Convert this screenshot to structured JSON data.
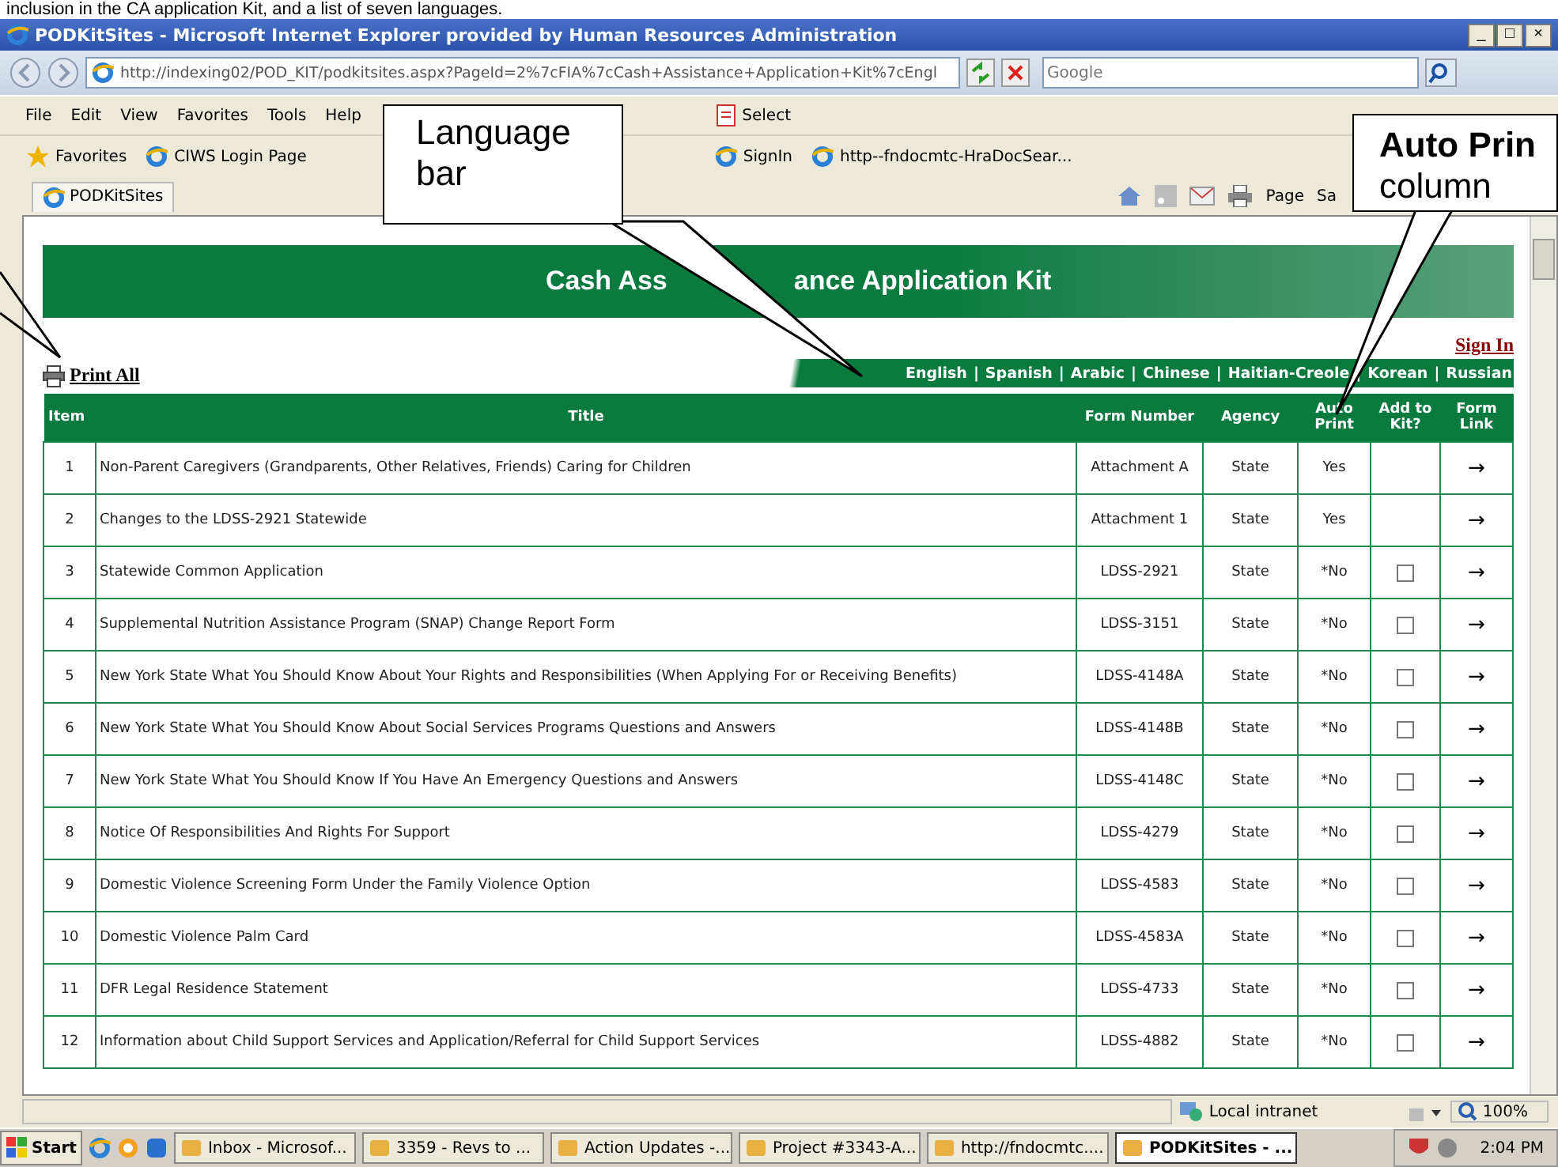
{
  "caption": "inclusion in the CA application Kit, and a list of seven languages.",
  "window": {
    "title": "PODKitSites - Microsoft Internet Explorer provided by Human Resources Administration",
    "controls": [
      "_",
      "□",
      "×"
    ]
  },
  "address_bar": {
    "url": "http://indexing02/POD_KIT/podkitsites.aspx?PageId=2%7cFIA%7cCash+Assistance+Application+Kit%7cEngl",
    "search_placeholder": "Google"
  },
  "menu": [
    "File",
    "Edit",
    "View",
    "Favorites",
    "Tools",
    "Help"
  ],
  "toolbar_right": [
    "Select"
  ],
  "favorites_bar": {
    "label": "Favorites",
    "items": [
      "CIWS Login Page",
      "SignIn",
      "http--fndocmtc-HraDocSear..."
    ]
  },
  "browser_tab": {
    "title": "PODKitSites"
  },
  "command_bar": [
    "Page",
    "Sa"
  ],
  "page": {
    "banner": [
      "Cash Ass",
      "ance Application Kit"
    ],
    "separator": "|",
    "sign_in": "Sign In",
    "print_all": "Print All",
    "languages": [
      "English",
      "Spanish",
      "Arabic",
      "Chinese",
      "Haitian-Creole",
      "Korean",
      "Russian"
    ],
    "table": {
      "columns": [
        "Item",
        "Title",
        "Form Number",
        "Agency",
        "Auto Print",
        "Add to Kit?",
        "Form Link"
      ],
      "rows": [
        {
          "item": "1",
          "title": "Non-Parent Caregivers (Grandparents, Other Relatives, Friends) Caring for Children",
          "form": "Attachment A",
          "agency": "State",
          "auto_print": "Yes",
          "link": "→"
        },
        {
          "item": "2",
          "title": "Changes to the LDSS-2921 Statewide",
          "form": "Attachment 1",
          "agency": "State",
          "auto_print": "Yes",
          "link": "→"
        },
        {
          "item": "3",
          "title": "Statewide Common Application",
          "form": "LDSS-2921",
          "agency": "State",
          "auto_print": "*No",
          "checked": false,
          "link": "→"
        },
        {
          "item": "4",
          "title": "Supplemental Nutrition Assistance Program (SNAP) Change Report Form",
          "form": "LDSS-3151",
          "agency": "State",
          "auto_print": "*No",
          "checked": false,
          "link": "→"
        },
        {
          "item": "5",
          "title": "New York State What You Should Know About Your Rights and Responsibilities (When Applying For or Receiving Benefits)",
          "form": "LDSS-4148A",
          "agency": "State",
          "auto_print": "*No",
          "checked": false,
          "link": "→"
        },
        {
          "item": "6",
          "title": "New York State What You Should Know About Social Services Programs Questions and Answers",
          "form": "LDSS-4148B",
          "agency": "State",
          "auto_print": "*No",
          "checked": false,
          "link": "→"
        },
        {
          "item": "7",
          "title": "New York State What You Should Know If You Have An Emergency Questions and Answers",
          "form": "LDSS-4148C",
          "agency": "State",
          "auto_print": "*No",
          "checked": false,
          "link": "→"
        },
        {
          "item": "8",
          "title": "Notice Of Responsibilities And Rights For Support",
          "form": "LDSS-4279",
          "agency": "State",
          "auto_print": "*No",
          "checked": false,
          "link": "→"
        },
        {
          "item": "9",
          "title": "Domestic Violence Screening Form Under the Family Violence Option",
          "form": "LDSS-4583",
          "agency": "State",
          "auto_print": "*No",
          "checked": false,
          "link": "→"
        },
        {
          "item": "10",
          "title": "Domestic Violence Palm Card",
          "form": "LDSS-4583A",
          "agency": "State",
          "auto_print": "*No",
          "checked": false,
          "link": "→"
        },
        {
          "item": "11",
          "title": "DFR Legal Residence Statement",
          "form": "LDSS-4733",
          "agency": "State",
          "auto_print": "*No",
          "checked": false,
          "link": "→"
        },
        {
          "item": "12",
          "title": "Information about Child Support Services and Application/Referral for Child Support Services",
          "form": "LDSS-4882",
          "agency": "State",
          "auto_print": "*No",
          "checked": false,
          "link": "→"
        }
      ]
    }
  },
  "status_bar": {
    "zone": "Local intranet",
    "zoom": "100%"
  },
  "taskbar": {
    "start": "Start",
    "items": [
      {
        "label": "Inbox - Microsof...",
        "selected": false
      },
      {
        "label": "3359 - Revs to ...",
        "selected": false
      },
      {
        "label": "Action Updates -...",
        "selected": false
      },
      {
        "label": "Project #3343-A...",
        "selected": false
      },
      {
        "label": "http://fndocmtc....",
        "selected": false
      },
      {
        "label": "PODKitSites - ...",
        "selected": true
      }
    ],
    "clock": "2:04 PM"
  },
  "callouts": [
    {
      "kind": "plain",
      "text": "Language bar"
    },
    {
      "kind": "titled",
      "text": "**Auto Prin** column"
    }
  ]
}
